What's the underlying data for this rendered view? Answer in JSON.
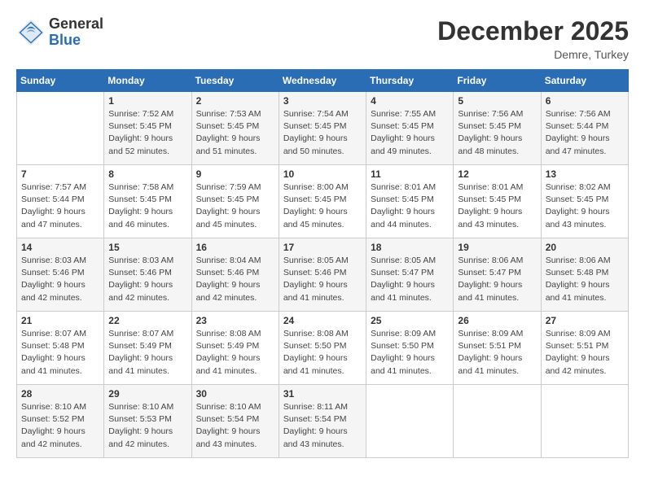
{
  "logo": {
    "general": "General",
    "blue": "Blue"
  },
  "header": {
    "month": "December 2025",
    "location": "Demre, Turkey"
  },
  "days_of_week": [
    "Sunday",
    "Monday",
    "Tuesday",
    "Wednesday",
    "Thursday",
    "Friday",
    "Saturday"
  ],
  "weeks": [
    [
      {
        "day": "",
        "info": ""
      },
      {
        "day": "1",
        "info": "Sunrise: 7:52 AM\nSunset: 5:45 PM\nDaylight: 9 hours\nand 52 minutes."
      },
      {
        "day": "2",
        "info": "Sunrise: 7:53 AM\nSunset: 5:45 PM\nDaylight: 9 hours\nand 51 minutes."
      },
      {
        "day": "3",
        "info": "Sunrise: 7:54 AM\nSunset: 5:45 PM\nDaylight: 9 hours\nand 50 minutes."
      },
      {
        "day": "4",
        "info": "Sunrise: 7:55 AM\nSunset: 5:45 PM\nDaylight: 9 hours\nand 49 minutes."
      },
      {
        "day": "5",
        "info": "Sunrise: 7:56 AM\nSunset: 5:45 PM\nDaylight: 9 hours\nand 48 minutes."
      },
      {
        "day": "6",
        "info": "Sunrise: 7:56 AM\nSunset: 5:44 PM\nDaylight: 9 hours\nand 47 minutes."
      }
    ],
    [
      {
        "day": "7",
        "info": "Sunrise: 7:57 AM\nSunset: 5:44 PM\nDaylight: 9 hours\nand 47 minutes."
      },
      {
        "day": "8",
        "info": "Sunrise: 7:58 AM\nSunset: 5:45 PM\nDaylight: 9 hours\nand 46 minutes."
      },
      {
        "day": "9",
        "info": "Sunrise: 7:59 AM\nSunset: 5:45 PM\nDaylight: 9 hours\nand 45 minutes."
      },
      {
        "day": "10",
        "info": "Sunrise: 8:00 AM\nSunset: 5:45 PM\nDaylight: 9 hours\nand 45 minutes."
      },
      {
        "day": "11",
        "info": "Sunrise: 8:01 AM\nSunset: 5:45 PM\nDaylight: 9 hours\nand 44 minutes."
      },
      {
        "day": "12",
        "info": "Sunrise: 8:01 AM\nSunset: 5:45 PM\nDaylight: 9 hours\nand 43 minutes."
      },
      {
        "day": "13",
        "info": "Sunrise: 8:02 AM\nSunset: 5:45 PM\nDaylight: 9 hours\nand 43 minutes."
      }
    ],
    [
      {
        "day": "14",
        "info": "Sunrise: 8:03 AM\nSunset: 5:46 PM\nDaylight: 9 hours\nand 42 minutes."
      },
      {
        "day": "15",
        "info": "Sunrise: 8:03 AM\nSunset: 5:46 PM\nDaylight: 9 hours\nand 42 minutes."
      },
      {
        "day": "16",
        "info": "Sunrise: 8:04 AM\nSunset: 5:46 PM\nDaylight: 9 hours\nand 42 minutes."
      },
      {
        "day": "17",
        "info": "Sunrise: 8:05 AM\nSunset: 5:46 PM\nDaylight: 9 hours\nand 41 minutes."
      },
      {
        "day": "18",
        "info": "Sunrise: 8:05 AM\nSunset: 5:47 PM\nDaylight: 9 hours\nand 41 minutes."
      },
      {
        "day": "19",
        "info": "Sunrise: 8:06 AM\nSunset: 5:47 PM\nDaylight: 9 hours\nand 41 minutes."
      },
      {
        "day": "20",
        "info": "Sunrise: 8:06 AM\nSunset: 5:48 PM\nDaylight: 9 hours\nand 41 minutes."
      }
    ],
    [
      {
        "day": "21",
        "info": "Sunrise: 8:07 AM\nSunset: 5:48 PM\nDaylight: 9 hours\nand 41 minutes."
      },
      {
        "day": "22",
        "info": "Sunrise: 8:07 AM\nSunset: 5:49 PM\nDaylight: 9 hours\nand 41 minutes."
      },
      {
        "day": "23",
        "info": "Sunrise: 8:08 AM\nSunset: 5:49 PM\nDaylight: 9 hours\nand 41 minutes."
      },
      {
        "day": "24",
        "info": "Sunrise: 8:08 AM\nSunset: 5:50 PM\nDaylight: 9 hours\nand 41 minutes."
      },
      {
        "day": "25",
        "info": "Sunrise: 8:09 AM\nSunset: 5:50 PM\nDaylight: 9 hours\nand 41 minutes."
      },
      {
        "day": "26",
        "info": "Sunrise: 8:09 AM\nSunset: 5:51 PM\nDaylight: 9 hours\nand 41 minutes."
      },
      {
        "day": "27",
        "info": "Sunrise: 8:09 AM\nSunset: 5:51 PM\nDaylight: 9 hours\nand 42 minutes."
      }
    ],
    [
      {
        "day": "28",
        "info": "Sunrise: 8:10 AM\nSunset: 5:52 PM\nDaylight: 9 hours\nand 42 minutes."
      },
      {
        "day": "29",
        "info": "Sunrise: 8:10 AM\nSunset: 5:53 PM\nDaylight: 9 hours\nand 42 minutes."
      },
      {
        "day": "30",
        "info": "Sunrise: 8:10 AM\nSunset: 5:54 PM\nDaylight: 9 hours\nand 43 minutes."
      },
      {
        "day": "31",
        "info": "Sunrise: 8:11 AM\nSunset: 5:54 PM\nDaylight: 9 hours\nand 43 minutes."
      },
      {
        "day": "",
        "info": ""
      },
      {
        "day": "",
        "info": ""
      },
      {
        "day": "",
        "info": ""
      }
    ]
  ]
}
